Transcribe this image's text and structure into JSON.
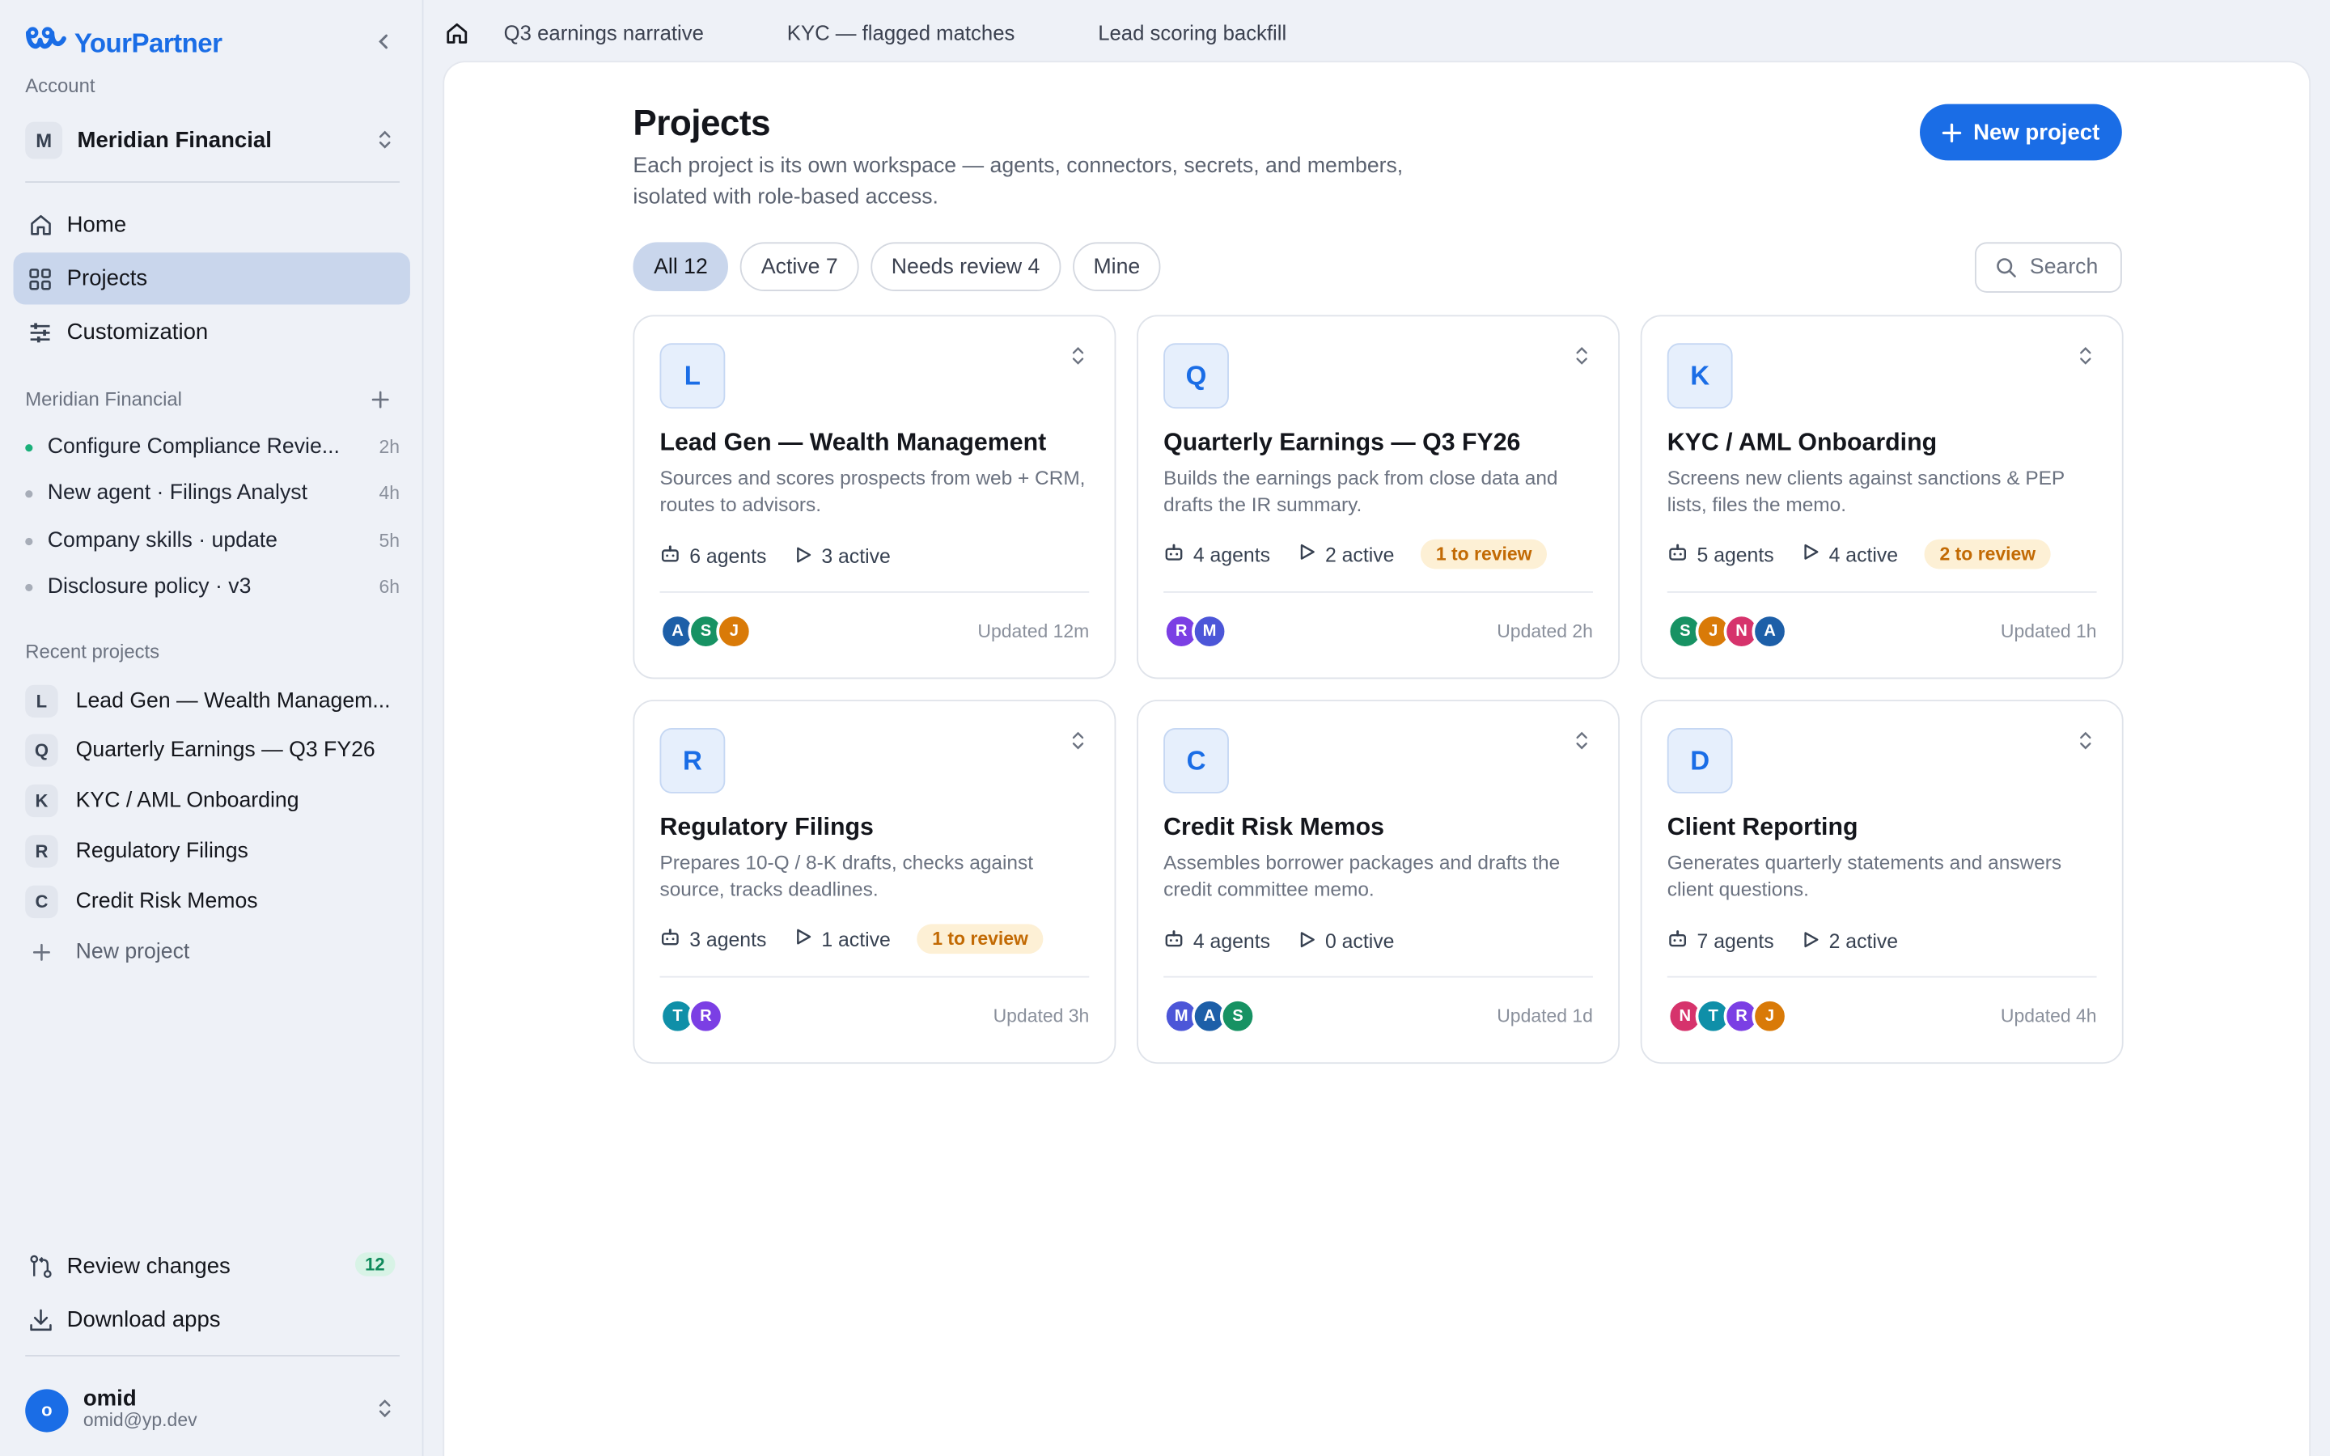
{
  "app": {
    "name": "YourPartner"
  },
  "sidebar": {
    "account_label": "Account",
    "account": {
      "initial": "M",
      "name": "Meridian Financial"
    },
    "nav": [
      {
        "label": "Home",
        "icon": "home-icon"
      },
      {
        "label": "Projects",
        "icon": "grid-icon",
        "active": true
      },
      {
        "label": "Customization",
        "icon": "sliders-icon"
      }
    ],
    "activity_label": "Meridian Financial",
    "activity": [
      {
        "label": "Configure Compliance Revie...",
        "time": "2h",
        "status": "active"
      },
      {
        "label": "New agent · Filings Analyst",
        "time": "4h",
        "status": "idle"
      },
      {
        "label": "Company skills · update",
        "time": "5h",
        "status": "idle"
      },
      {
        "label": "Disclosure policy · v3",
        "time": "6h",
        "status": "idle"
      }
    ],
    "recent_label": "Recent projects",
    "recent": [
      {
        "initial": "L",
        "label": "Lead Gen — Wealth Managem..."
      },
      {
        "initial": "Q",
        "label": "Quarterly Earnings — Q3 FY26"
      },
      {
        "initial": "K",
        "label": "KYC / AML Onboarding"
      },
      {
        "initial": "R",
        "label": "Regulatory Filings"
      },
      {
        "initial": "C",
        "label": "Credit Risk Memos"
      }
    ],
    "new_project": "New project",
    "review_changes": {
      "label": "Review changes",
      "count": "12"
    },
    "download_apps": "Download apps",
    "user": {
      "initial": "o",
      "name": "omid",
      "email": "omid@yp.dev"
    }
  },
  "tabs": [
    "Q3 earnings narrative",
    "KYC — flagged matches",
    "Lead scoring backfill"
  ],
  "main": {
    "title": "Projects",
    "subtitle": "Each project is its own workspace — agents, connectors, secrets, and members, isolated with role-based access.",
    "new_button": "New project",
    "filters": [
      "All 12",
      "Active 7",
      "Needs review 4",
      "Mine"
    ],
    "active_filter": "All 12",
    "search_placeholder": "Search",
    "projects": [
      {
        "initial": "L",
        "name": "Lead Gen — Wealth Management",
        "desc": "Sources and scores prospects from web + CRM, routes to advisors.",
        "agents": "6 agents",
        "active": "3 active",
        "review": "",
        "members": [
          "A",
          "S",
          "J"
        ],
        "updated": "Updated 12m"
      },
      {
        "initial": "Q",
        "name": "Quarterly Earnings — Q3 FY26",
        "desc": "Builds the earnings pack from close data and drafts the IR summary.",
        "agents": "4 agents",
        "active": "2 active",
        "review": "1 to review",
        "members": [
          "R",
          "M"
        ],
        "updated": "Updated 2h"
      },
      {
        "initial": "K",
        "name": "KYC / AML Onboarding",
        "desc": "Screens new clients against sanctions & PEP lists, files the memo.",
        "agents": "5 agents",
        "active": "4 active",
        "review": "2 to review",
        "members": [
          "S",
          "J",
          "N",
          "A"
        ],
        "updated": "Updated 1h"
      },
      {
        "initial": "R",
        "name": "Regulatory Filings",
        "desc": "Prepares 10-Q / 8-K drafts, checks against source, tracks deadlines.",
        "agents": "3 agents",
        "active": "1 active",
        "review": "1 to review",
        "members": [
          "T",
          "R"
        ],
        "updated": "Updated 3h"
      },
      {
        "initial": "C",
        "name": "Credit Risk Memos",
        "desc": "Assembles borrower packages and drafts the credit committee memo.",
        "agents": "4 agents",
        "active": "0 active",
        "review": "",
        "members": [
          "M",
          "A",
          "S"
        ],
        "updated": "Updated 1d"
      },
      {
        "initial": "D",
        "name": "Client Reporting",
        "desc": "Generates quarterly statements and answers client questions.",
        "agents": "7 agents",
        "active": "2 active",
        "review": "",
        "members": [
          "N",
          "T",
          "R",
          "J"
        ],
        "updated": "Updated 4h"
      }
    ]
  },
  "colors": {
    "accent": "#1a6de6",
    "selected": "#c9d6ec",
    "review_bg": "#fdf0d5",
    "review_fg": "#c26a04",
    "member_A": "#1d5fa8",
    "member_S": "#179263",
    "member_J": "#d97a08",
    "member_R": "#7b3fe4",
    "member_M": "#4c56d8",
    "member_N": "#d6336c",
    "member_T": "#0f8fa8"
  }
}
